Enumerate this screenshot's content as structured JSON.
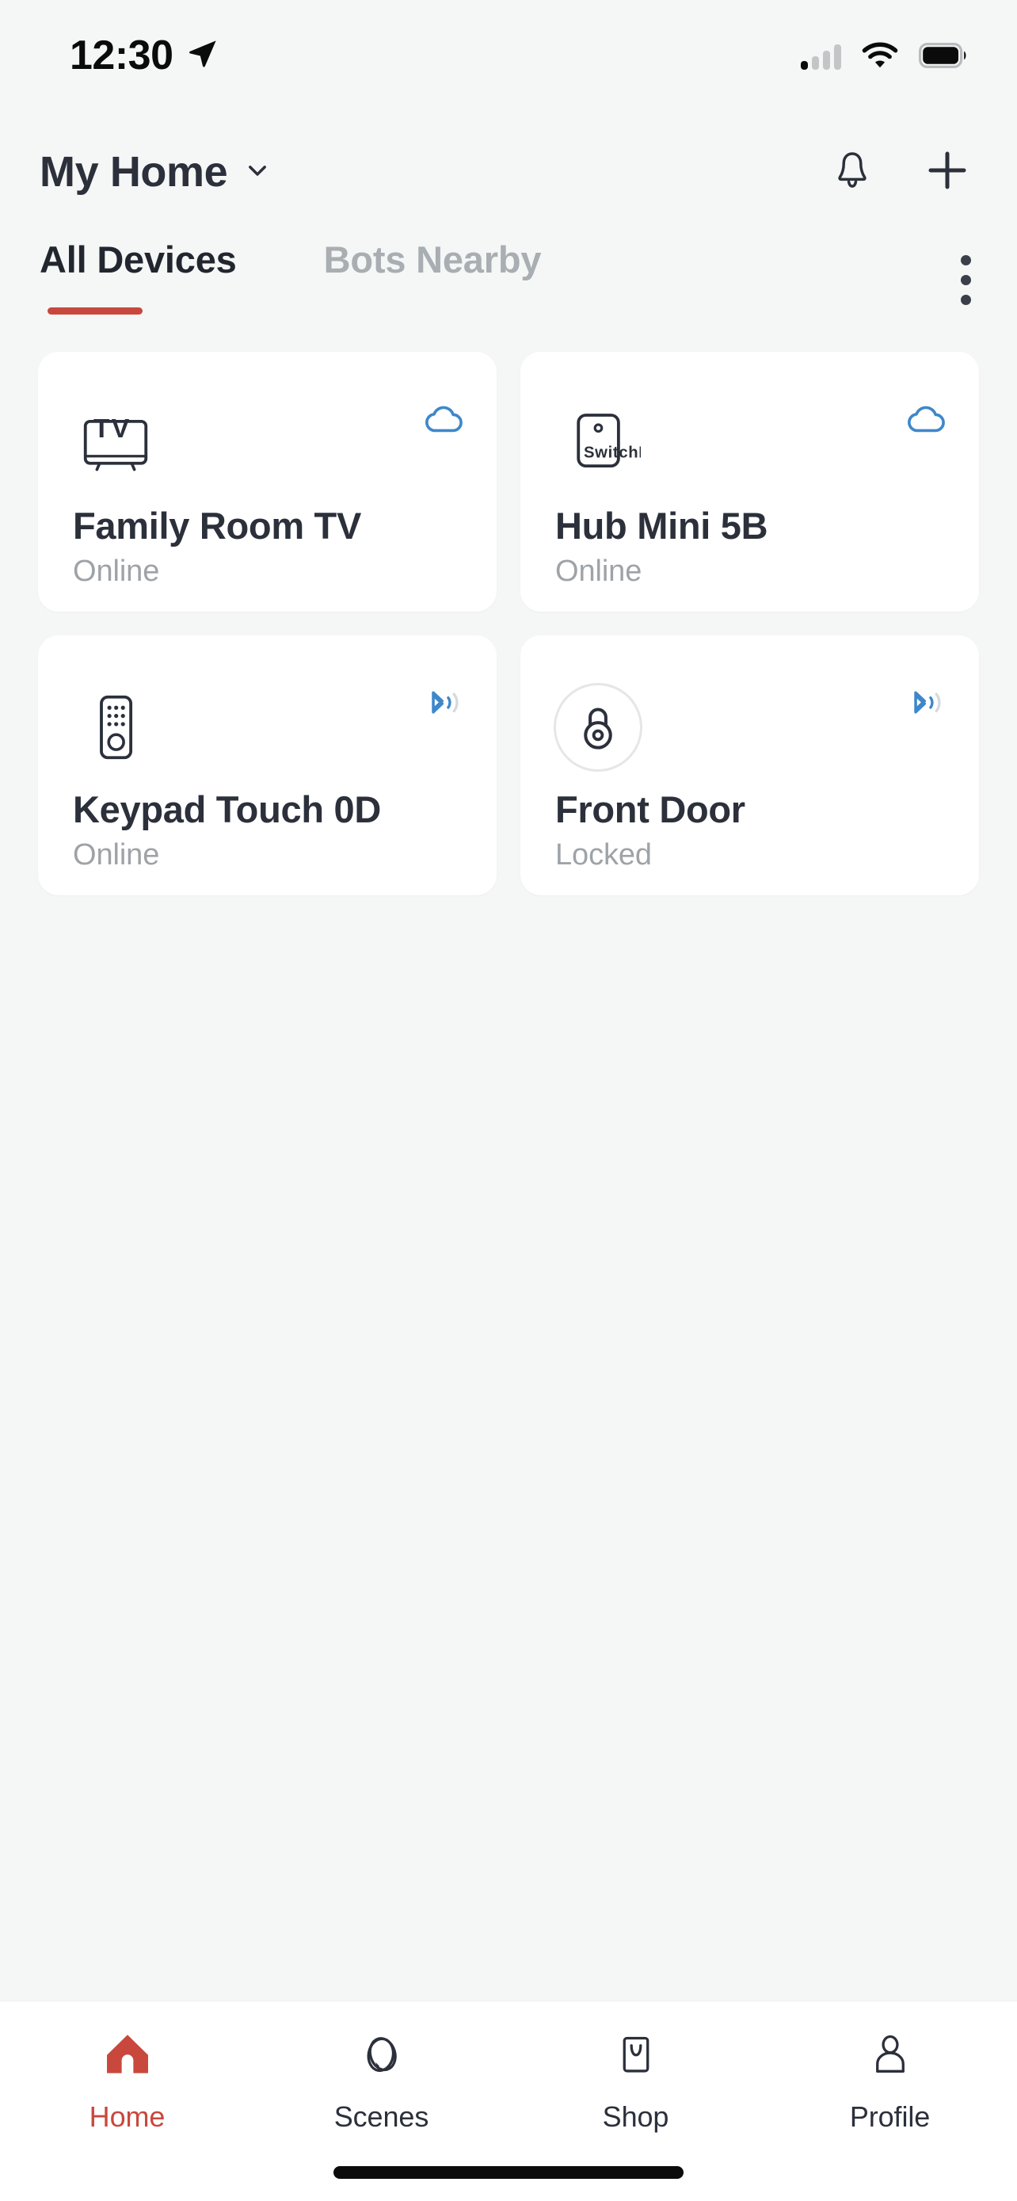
{
  "status_bar": {
    "time": "12:30",
    "location_icon": "location-arrow-icon",
    "signal_icon": "cellular-signal-icon",
    "signal_bars_filled": 1,
    "signal_bars_total": 4,
    "wifi_icon": "wifi-icon",
    "battery_icon": "battery-full-icon"
  },
  "header": {
    "home_name": "My Home",
    "chevron_icon": "chevron-down-icon",
    "notifications_icon": "bell-icon",
    "add_icon": "plus-icon"
  },
  "tabs": {
    "items": [
      {
        "label": "All Devices",
        "active": true
      },
      {
        "label": "Bots Nearby",
        "active": false
      }
    ],
    "overflow_icon": "kebab-menu-icon",
    "active_underline_color": "#C8483E"
  },
  "devices": [
    {
      "name": "Family Room TV",
      "status": "Online",
      "device_icon": "tv-icon",
      "device_icon_label": "TV",
      "connection_icon": "cloud-icon",
      "connection_color": "#3E87CB",
      "ringed": false
    },
    {
      "name": "Hub Mini 5B",
      "status": "Online",
      "device_icon": "hub-mini-icon",
      "device_icon_label": "SwitchBot",
      "connection_icon": "cloud-icon",
      "connection_color": "#3E87CB",
      "ringed": false
    },
    {
      "name": "Keypad Touch 0D",
      "status": "Online",
      "device_icon": "keypad-icon",
      "device_icon_label": "",
      "connection_icon": "bluetooth-signal-icon",
      "connection_color": "#3E87CB",
      "ringed": false
    },
    {
      "name": "Front Door",
      "status": "Locked",
      "device_icon": "lock-icon",
      "device_icon_label": "",
      "connection_icon": "bluetooth-signal-icon",
      "connection_color": "#3E87CB",
      "ringed": true
    }
  ],
  "bottom_nav": {
    "items": [
      {
        "label": "Home",
        "icon": "house-icon",
        "active": true
      },
      {
        "label": "Scenes",
        "icon": "orbit-icon",
        "active": false
      },
      {
        "label": "Shop",
        "icon": "bag-icon",
        "active": false
      },
      {
        "label": "Profile",
        "icon": "person-icon",
        "active": false
      }
    ],
    "active_color": "#C8483E",
    "home_indicator": "home-indicator"
  },
  "theme": {
    "background": "#F5F7F6",
    "card_background": "#FFFFFF",
    "accent_red": "#C8483E",
    "accent_blue": "#3E87CB",
    "text_primary": "#2B303B",
    "text_muted": "#9EA3A8"
  }
}
